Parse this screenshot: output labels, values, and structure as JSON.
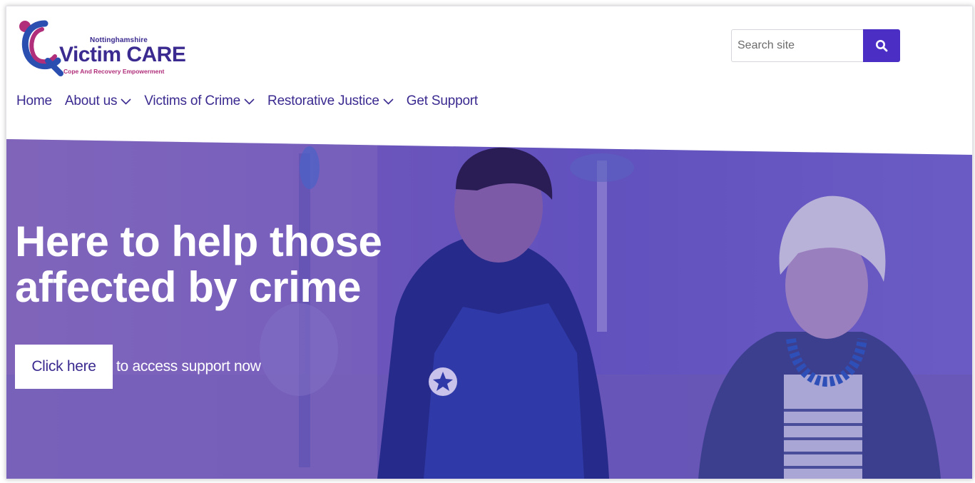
{
  "logo": {
    "small_text": "Nottinghamshire",
    "main_text": "Victim CARE",
    "tagline": "Cope And Recovery Empowerment",
    "colors": {
      "purple": "#3b2a8f",
      "pink": "#b02e7a",
      "blue": "#2a4fb0"
    }
  },
  "search": {
    "placeholder": "Search site",
    "value": "",
    "icon": "search-icon"
  },
  "nav": {
    "items": [
      {
        "label": "Home",
        "has_dropdown": false
      },
      {
        "label": "About us",
        "has_dropdown": true
      },
      {
        "label": "Victims of Crime",
        "has_dropdown": true
      },
      {
        "label": "Restorative Justice",
        "has_dropdown": true
      },
      {
        "label": "Get Support",
        "has_dropdown": false
      }
    ]
  },
  "hero": {
    "title_line1": "Here to help those",
    "title_line2": "affected by crime",
    "cta_button": "Click here",
    "cta_text": "to access support now"
  },
  "theme": {
    "accent": "#4b2fc4",
    "nav_text": "#3b2a8f",
    "hero_overlay": "#6a52c0"
  }
}
